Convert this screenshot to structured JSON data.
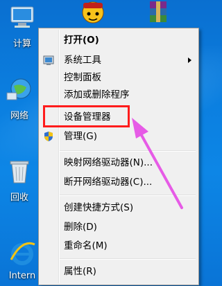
{
  "desktop": {
    "icons": [
      {
        "label": "计算",
        "icon": "computer-icon"
      },
      {
        "label": "网络",
        "icon": "network-icon"
      },
      {
        "label": "回收",
        "icon": "recycle-bin-icon"
      },
      {
        "label": "Intern",
        "icon": "ie-icon"
      }
    ]
  },
  "context_menu": {
    "items": [
      {
        "label": "打开(O)",
        "bold": true
      },
      {
        "label": "系统工具",
        "submenu": true,
        "icon": "system-tools-icon"
      },
      {
        "label": "控制面板"
      },
      {
        "label": "添加或删除程序"
      },
      {
        "label": "设备管理器",
        "highlighted": true
      },
      {
        "label": "管理(G)",
        "icon": "shield-icon"
      },
      {
        "label": "映射网络驱动器(N)..."
      },
      {
        "label": "断开网络驱动器(C)..."
      },
      {
        "label": "创建快捷方式(S)"
      },
      {
        "label": "删除(D)"
      },
      {
        "label": "重命名(M)"
      },
      {
        "label": "属性(R)"
      }
    ]
  },
  "annotation": {
    "highlight_color": "#ff1c1c",
    "arrow_color": "#e65be6"
  }
}
